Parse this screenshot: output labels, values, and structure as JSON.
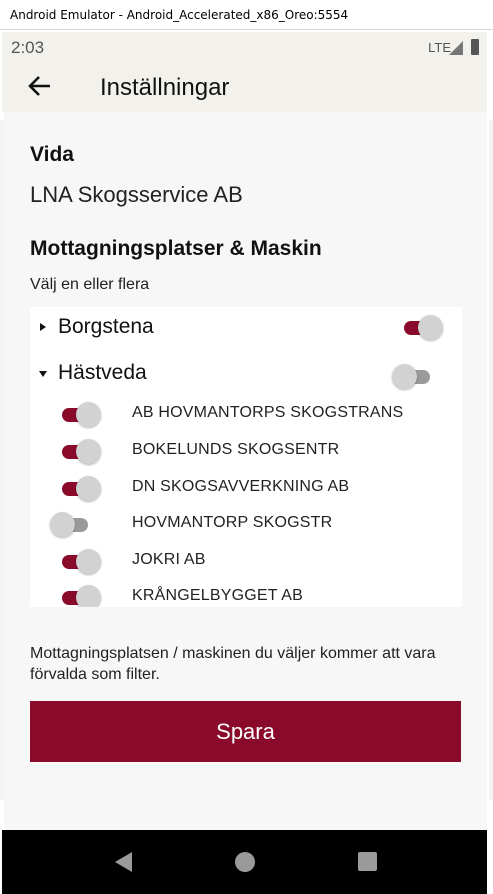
{
  "window": {
    "title": "Android Emulator - Android_Accelerated_x86_Oreo:5554"
  },
  "status_bar": {
    "time": "2:03",
    "network": "LTE"
  },
  "app_bar": {
    "title": "Inställningar"
  },
  "vida": {
    "heading": "Vida",
    "company": "LNA Skogsservice AB"
  },
  "receiving": {
    "heading": "Mottagningsplatser & Maskin",
    "subtitle": "Välj en eller flera",
    "groups": [
      {
        "name": "Borgstena",
        "expanded": false,
        "enabled": true
      },
      {
        "name": "Hästveda",
        "expanded": true,
        "enabled": false
      }
    ],
    "items": [
      {
        "label": "AB HOVMANTORPS SKOGSTRANS",
        "enabled": true
      },
      {
        "label": "BOKELUNDS SKOGSENTR",
        "enabled": true
      },
      {
        "label": "DN SKOGSAVVERKNING AB",
        "enabled": true
      },
      {
        "label": "HOVMANTORP SKOGSTR",
        "enabled": false
      },
      {
        "label": "JOKRI AB",
        "enabled": true
      },
      {
        "label": "KRÅNGELBYGGET AB",
        "enabled": true
      }
    ]
  },
  "hint": "Mottagningsplatsen / maskinen du väljer kommer att vara förvalda som filter.",
  "save_button": {
    "label": "Spara"
  },
  "colors": {
    "accent": "#8a0a2c",
    "switch_off": "#9a9a9a",
    "knob": "#d2d2d2",
    "background": "#f7f7f7"
  },
  "icons": {
    "back": "arrow-left-icon",
    "nav_back": "triangle-back-icon",
    "nav_home": "circle-home-icon",
    "nav_recent": "square-recent-icon"
  }
}
